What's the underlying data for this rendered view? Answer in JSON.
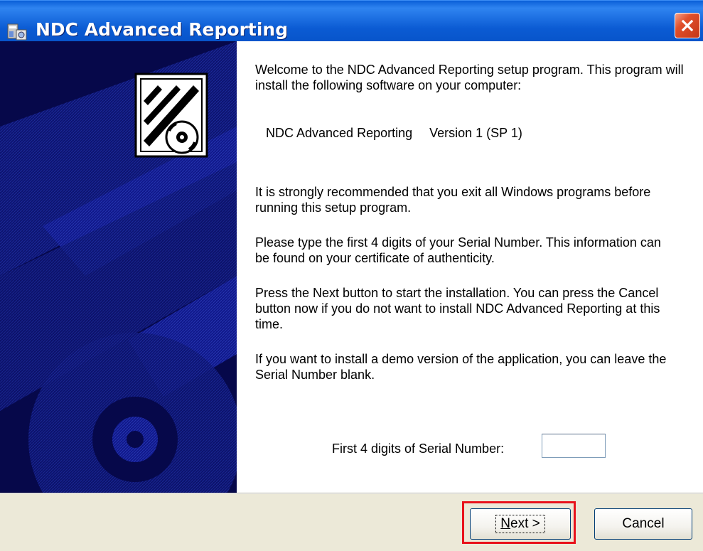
{
  "window": {
    "title": "NDC Advanced Reporting",
    "icon": "setup-installer-icon",
    "close_icon": "close-icon"
  },
  "content": {
    "welcome": "Welcome to the NDC Advanced Reporting setup program. This program will install the following software on your computer:",
    "product_name": "NDC Advanced Reporting",
    "product_version": "Version 1 (SP 1)",
    "recommendation": "It is strongly recommended that you exit all Windows programs before running this setup program.",
    "serial_instructions": "Please type the first 4 digits of your Serial Number.  This information can be found on your certificate of authenticity.",
    "next_instructions": "Press the Next button to start the installation. You can press the Cancel button now if you do not want to install NDC Advanced Reporting at this time.",
    "demo_instructions": "If you want to install a demo version of the application, you can leave the Serial Number blank.",
    "serial_label": "First 4 digits of Serial Number:",
    "serial_value": ""
  },
  "buttons": {
    "next_mnemonic": "N",
    "next_rest": "ext >",
    "cancel": "Cancel"
  },
  "colors": {
    "titlebar": "#0a5fd8",
    "banner": "#06084a",
    "highlight": "#e8121b"
  }
}
